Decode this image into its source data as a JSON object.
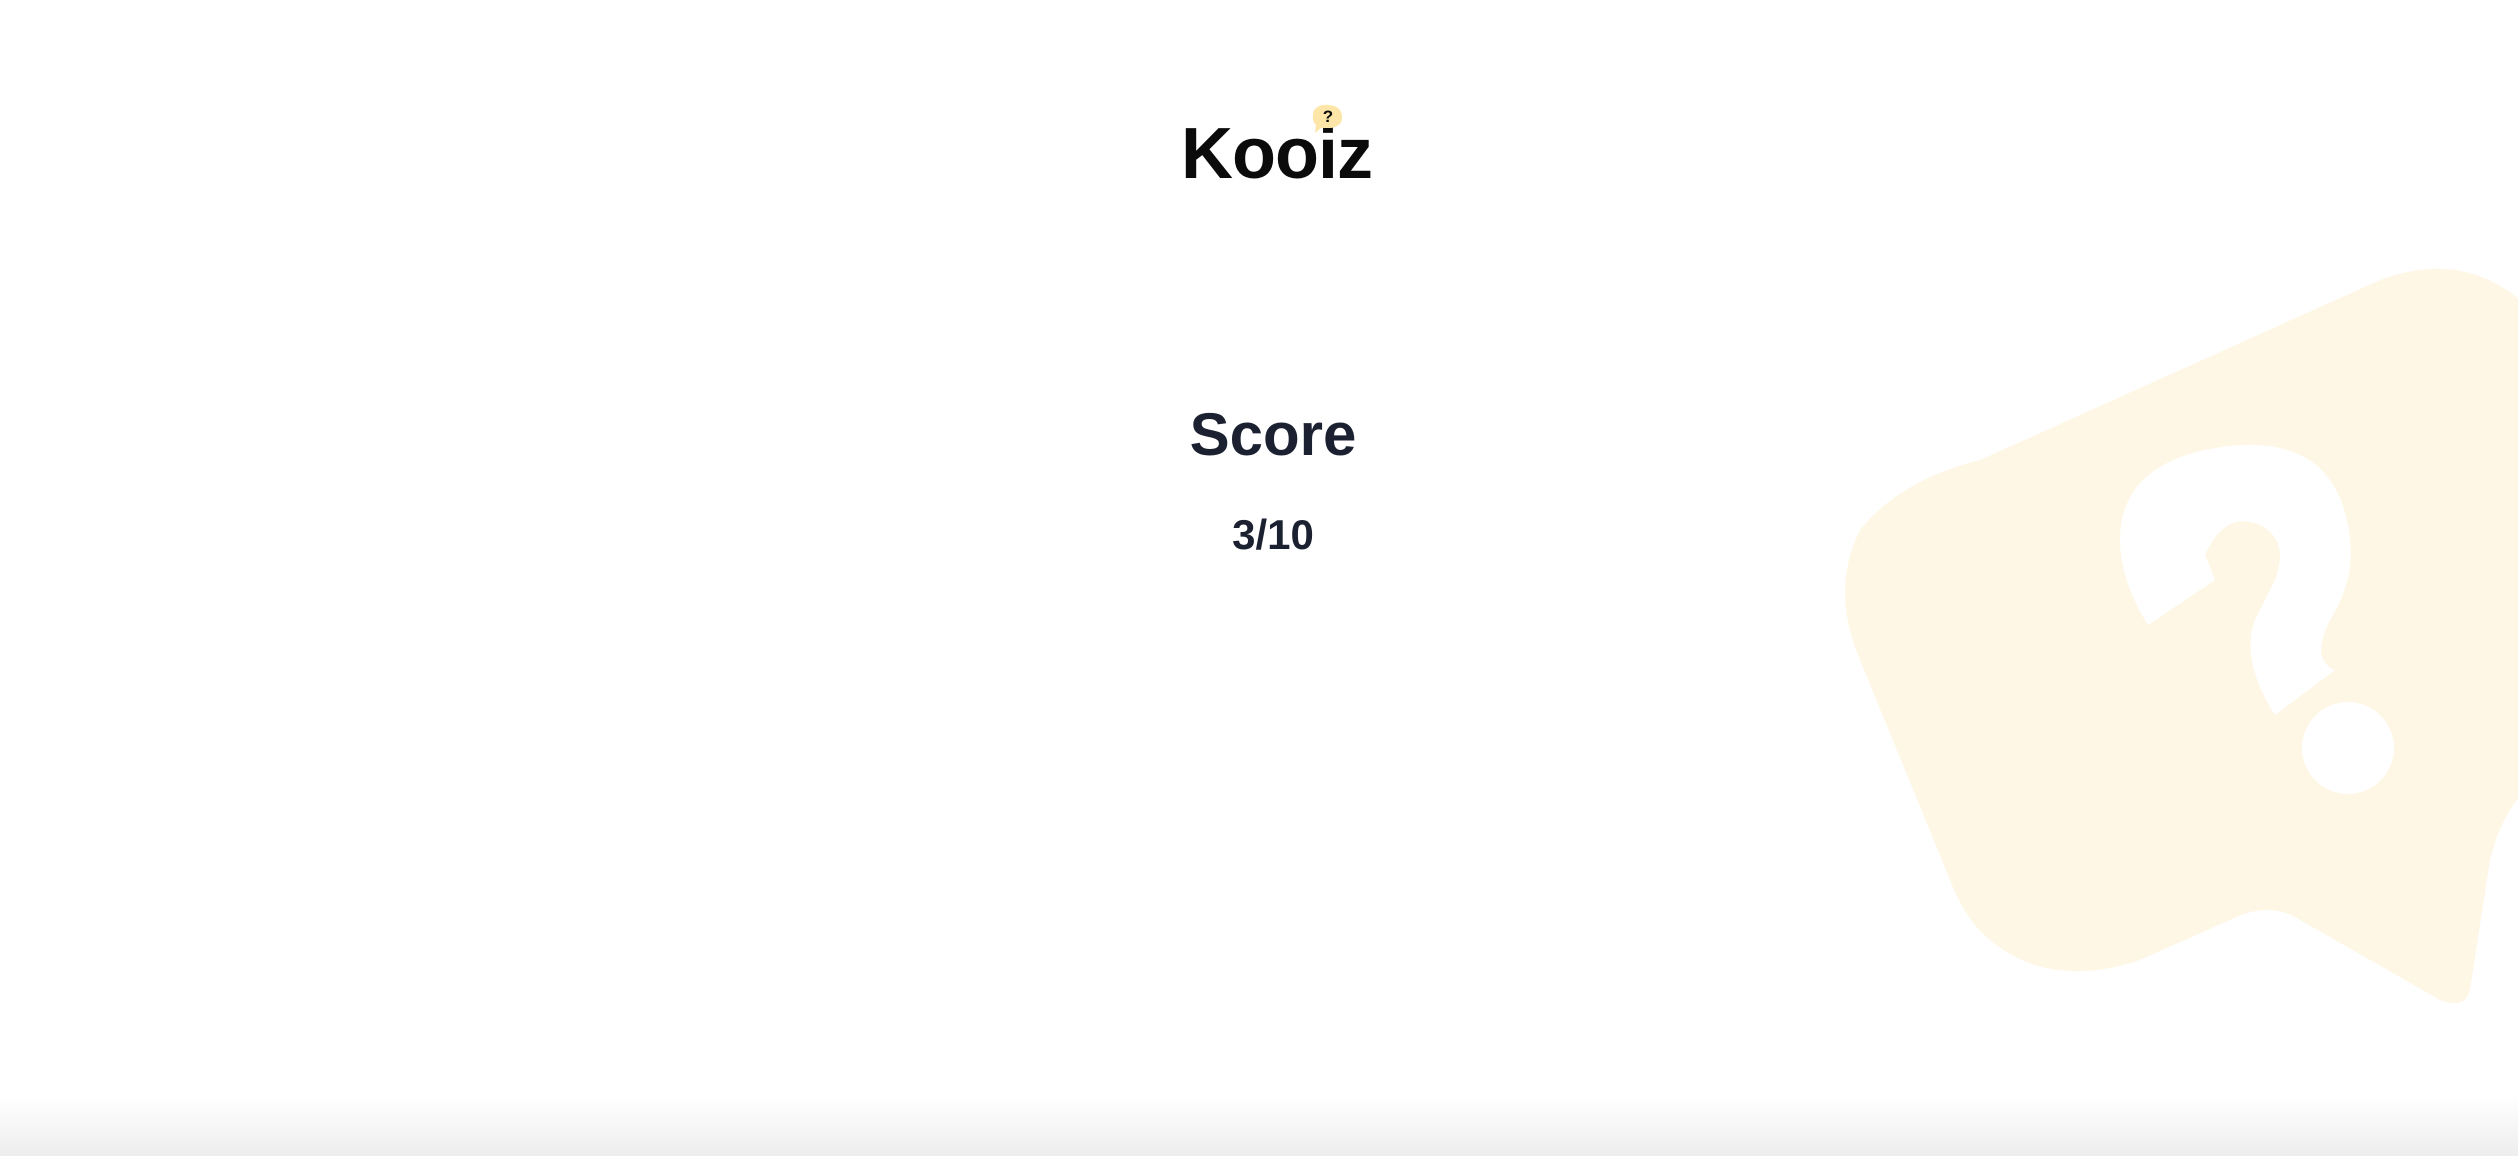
{
  "app": {
    "logo_text": "Kooiz",
    "logo_badge_glyph": "?",
    "logo_badge_color": "#fde6a8"
  },
  "score": {
    "title": "Score",
    "value": "3/10"
  },
  "decoration": {
    "icon": "question-speech-bubble-icon",
    "color": "#fff7e6"
  },
  "colors": {
    "background": "#ffffff",
    "text": "#1b2130",
    "logo_text": "#0b0b0b"
  }
}
